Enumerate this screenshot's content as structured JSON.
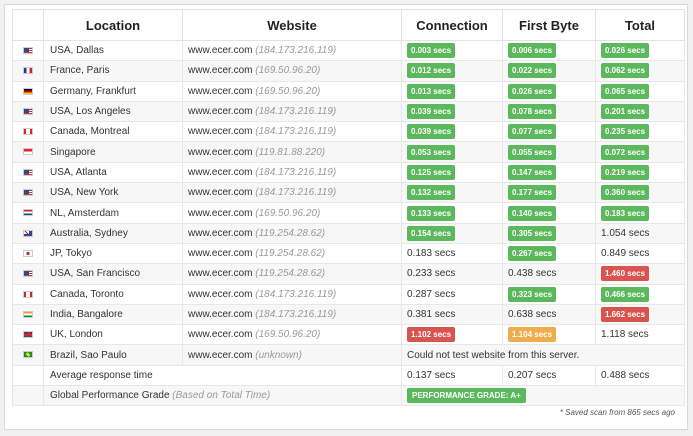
{
  "headers": {
    "location": "Location",
    "website": "Website",
    "connection": "Connection",
    "first_byte": "First Byte",
    "total": "Total"
  },
  "rows": [
    {
      "flag": "us",
      "location": "USA, Dallas",
      "website": "www.ecer.com",
      "ip": "(184.173.216.119)",
      "connection": {
        "v": "0.003 secs",
        "s": "g"
      },
      "first_byte": {
        "v": "0.006 secs",
        "s": "g"
      },
      "total": {
        "v": "0.026 secs",
        "s": "g"
      }
    },
    {
      "flag": "fr",
      "location": "France, Paris",
      "website": "www.ecer.com",
      "ip": "(169.50.96.20)",
      "connection": {
        "v": "0.012 secs",
        "s": "g"
      },
      "first_byte": {
        "v": "0.022 secs",
        "s": "g"
      },
      "total": {
        "v": "0.062 secs",
        "s": "g"
      }
    },
    {
      "flag": "de",
      "location": "Germany, Frankfurt",
      "website": "www.ecer.com",
      "ip": "(169.50.96.20)",
      "connection": {
        "v": "0.013 secs",
        "s": "g"
      },
      "first_byte": {
        "v": "0.026 secs",
        "s": "g"
      },
      "total": {
        "v": "0.065 secs",
        "s": "g"
      }
    },
    {
      "flag": "us",
      "location": "USA, Los Angeles",
      "website": "www.ecer.com",
      "ip": "(184.173.216.119)",
      "connection": {
        "v": "0.039 secs",
        "s": "g"
      },
      "first_byte": {
        "v": "0.078 secs",
        "s": "g"
      },
      "total": {
        "v": "0.201 secs",
        "s": "g"
      }
    },
    {
      "flag": "ca",
      "location": "Canada, Montreal",
      "website": "www.ecer.com",
      "ip": "(184.173.216.119)",
      "connection": {
        "v": "0.039 secs",
        "s": "g"
      },
      "first_byte": {
        "v": "0.077 secs",
        "s": "g"
      },
      "total": {
        "v": "0.235 secs",
        "s": "g"
      }
    },
    {
      "flag": "sg",
      "location": "Singapore",
      "website": "www.ecer.com",
      "ip": "(119.81.88.220)",
      "connection": {
        "v": "0.053 secs",
        "s": "g"
      },
      "first_byte": {
        "v": "0.055 secs",
        "s": "g"
      },
      "total": {
        "v": "0.072 secs",
        "s": "g"
      }
    },
    {
      "flag": "us",
      "location": "USA, Atlanta",
      "website": "www.ecer.com",
      "ip": "(184.173.216.119)",
      "connection": {
        "v": "0.125 secs",
        "s": "g"
      },
      "first_byte": {
        "v": "0.147 secs",
        "s": "g"
      },
      "total": {
        "v": "0.219 secs",
        "s": "g"
      }
    },
    {
      "flag": "us",
      "location": "USA, New York",
      "website": "www.ecer.com",
      "ip": "(184.173.216.119)",
      "connection": {
        "v": "0.132 secs",
        "s": "g"
      },
      "first_byte": {
        "v": "0.177 secs",
        "s": "g"
      },
      "total": {
        "v": "0.360 secs",
        "s": "g"
      }
    },
    {
      "flag": "nl",
      "location": "NL, Amsterdam",
      "website": "www.ecer.com",
      "ip": "(169.50.96.20)",
      "connection": {
        "v": "0.133 secs",
        "s": "g"
      },
      "first_byte": {
        "v": "0.140 secs",
        "s": "g"
      },
      "total": {
        "v": "0.183 secs",
        "s": "g"
      }
    },
    {
      "flag": "au",
      "location": "Australia, Sydney",
      "website": "www.ecer.com",
      "ip": "(119.254.28.62)",
      "connection": {
        "v": "0.154 secs",
        "s": "g"
      },
      "first_byte": {
        "v": "0.305 secs",
        "s": "g"
      },
      "total": {
        "v": "1.054 secs",
        "s": ""
      }
    },
    {
      "flag": "jp",
      "location": "JP, Tokyo",
      "website": "www.ecer.com",
      "ip": "(119.254.28.62)",
      "connection": {
        "v": "0.183 secs",
        "s": ""
      },
      "first_byte": {
        "v": "0.267 secs",
        "s": "g"
      },
      "total": {
        "v": "0.849 secs",
        "s": ""
      }
    },
    {
      "flag": "us",
      "location": "USA, San Francisco",
      "website": "www.ecer.com",
      "ip": "(119.254.28.62)",
      "connection": {
        "v": "0.233 secs",
        "s": ""
      },
      "first_byte": {
        "v": "0.438 secs",
        "s": ""
      },
      "total": {
        "v": "1.460 secs",
        "s": "r"
      }
    },
    {
      "flag": "ca",
      "location": "Canada, Toronto",
      "website": "www.ecer.com",
      "ip": "(184.173.216.119)",
      "connection": {
        "v": "0.287 secs",
        "s": ""
      },
      "first_byte": {
        "v": "0.323 secs",
        "s": "g"
      },
      "total": {
        "v": "0.466 secs",
        "s": "g"
      }
    },
    {
      "flag": "in",
      "location": "India, Bangalore",
      "website": "www.ecer.com",
      "ip": "(184.173.216.119)",
      "connection": {
        "v": "0.381 secs",
        "s": ""
      },
      "first_byte": {
        "v": "0.638 secs",
        "s": ""
      },
      "total": {
        "v": "1.662 secs",
        "s": "r"
      }
    },
    {
      "flag": "gb",
      "location": "UK, London",
      "website": "www.ecer.com",
      "ip": "(169.50.96.20)",
      "connection": {
        "v": "1.102 secs",
        "s": "r"
      },
      "first_byte": {
        "v": "1.104 secs",
        "s": "o"
      },
      "total": {
        "v": "1.118 secs",
        "s": ""
      }
    }
  ],
  "brazil": {
    "flag": "br",
    "location": "Brazil, Sao Paulo",
    "website": "www.ecer.com",
    "ip": "(unknown)",
    "message": "Could not test website from this server."
  },
  "average": {
    "label": "Average response time",
    "connection": "0.137 secs",
    "first_byte": "0.207 secs",
    "total": "0.488 secs"
  },
  "grade": {
    "label": "Global Performance Grade",
    "sub": "(Based on Total Time)",
    "badge": "PERFORMANCE GRADE: A+"
  },
  "footer": "* Saved scan from 865 secs ago",
  "colors": {
    "green": "#5cb85c",
    "red": "#d9534f",
    "orange": "#f0ad4e"
  }
}
